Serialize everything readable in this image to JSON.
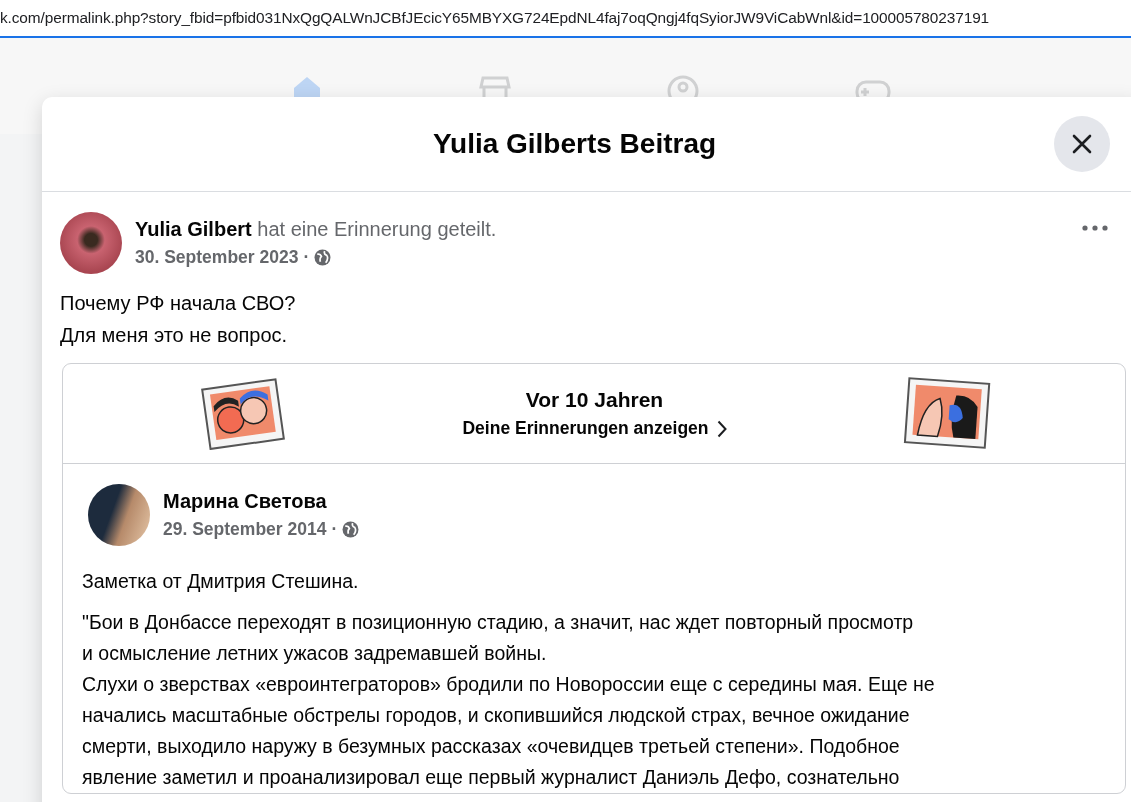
{
  "address_bar": {
    "url": "k.com/permalink.php?story_fbid=pfbid031NxQgQALWnJCBfJEcicY65MBYXG724EpdNL4faj7oqQngj4fqSyiorJW9ViCabWnl&id=100005780237191"
  },
  "nav": [
    {
      "kind": "home",
      "selected": true
    },
    {
      "kind": "marketplace",
      "selected": false
    },
    {
      "kind": "groups",
      "selected": false
    },
    {
      "kind": "gaming",
      "selected": false
    }
  ],
  "dialog": {
    "title": "Yulia Gilberts Beitrag",
    "post": {
      "author": "Yulia Gilbert",
      "action": "hat eine Erinnerung geteilt.",
      "date": "30. September 2023",
      "separator": "·",
      "text_lines": [
        "Почему РФ начала СВО?",
        "Для меня это не вопрос."
      ],
      "memory": {
        "heading": "Vor 10 Jahren",
        "link": "Deine Erinnerungen anzeigen",
        "shared_post": {
          "author": "Марина Светова",
          "date": "29. September 2014",
          "separator": "·",
          "paragraphs": [
            [
              "Заметка от Дмитрия Стешина."
            ],
            [
              "\"Бои в Донбассе переходят в позиционную стадию, а значит, нас ждет повторный просмотр",
              "и осмысление летних ужасов задремавшей войны.",
              "Слухи о зверствах «евроинтеграторов» бродили по Новороссии еще с середины мая. Еще не",
              "начались масштабные обстрелы городов, и скопившийся людской страх, вечное ожидание",
              "смерти, выходило наружу в безумных рассказах «очевидцев третьей степени». Подобное",
              "явление заметил и проанализировал еще первый журналист Даниэль Дефо, сознательно"
            ]
          ]
        }
      }
    }
  }
}
